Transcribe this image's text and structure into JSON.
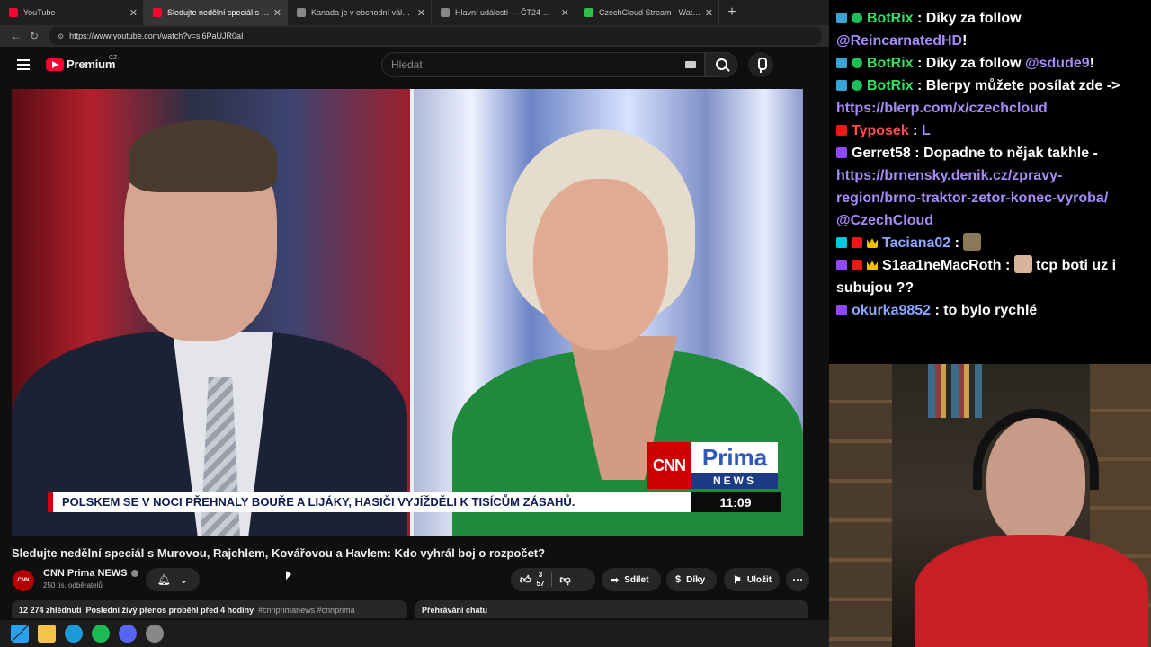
{
  "browser": {
    "tabs": [
      {
        "title": "YouTube",
        "favicon_color": "#ff0033",
        "active": false
      },
      {
        "title": "Sledujte nedělní speciál s Murovou",
        "favicon_color": "#ff0033",
        "active": true
      },
      {
        "title": "Kanada je v obchodní válce, nebo",
        "favicon_color": "#888888",
        "active": false
      },
      {
        "title": "Hlavní události — ČT24 — Česká t",
        "favicon_color": "#888888",
        "active": false
      },
      {
        "title": "CzechCloud Stream - Watch Live o",
        "favicon_color": "#2fbf4a",
        "active": false
      }
    ],
    "url": "https://www.youtube.com/watch?v=sl6PaUJR0aI"
  },
  "youtube": {
    "brand": "Premium",
    "country": "CZ",
    "search_placeholder": "Hledat"
  },
  "video": {
    "ticker": "POLSKEM SE V NOCI PŘEHNALY BOUŘE A LIJÁKY, HASIČI VYJÍŽDĚLI K TISÍCŮM ZÁSAHŮ.",
    "time": "11:09",
    "logo_cnn": "CNN",
    "logo_prima": "Prima",
    "logo_news": "NEWS"
  },
  "meta": {
    "title": "Sledujte nedělní speciál s Murovou, Rajchlem, Kovářovou a Havlem: Kdo vyhrál boj o rozpočet?",
    "channel_name": "CNN Prima NEWS",
    "subscribers": "250 tis. odběratelů",
    "like_top": "3",
    "like_bottom": "57",
    "share_label": "Sdílet",
    "thanks_label": "Díky",
    "save_label": "Uložit",
    "views": "12 274 zhlédnutí",
    "stream_info": "Poslední živý přenos proběhl před 4 hodiny",
    "hashtags": "#cnnprimanews #cnnprima",
    "chat_replay": "Přehrávání chatu"
  },
  "chat": [
    {
      "user": "BotRix",
      "color": "#32e35b",
      "badges": [
        "bot",
        "check"
      ],
      "parts": [
        {
          "t": " : Díky za follow ",
          "link": false
        },
        {
          "t": "@ReincarnatedHD",
          "link": true
        },
        {
          "t": "!",
          "link": false
        }
      ]
    },
    {
      "user": "BotRix",
      "color": "#32e35b",
      "badges": [
        "bot",
        "check"
      ],
      "parts": [
        {
          "t": " : Díky za follow ",
          "link": false
        },
        {
          "t": "@sdude9",
          "link": true
        },
        {
          "t": "!",
          "link": false
        }
      ]
    },
    {
      "user": "BotRix",
      "color": "#32e35b",
      "badges": [
        "bot",
        "check"
      ],
      "parts": [
        {
          "t": " : Blerpy můžete posílat zde -> ",
          "link": false
        },
        {
          "t": "https://blerp.com/x/czechcloud",
          "link": true
        }
      ]
    },
    {
      "user": "Typosek",
      "color": "#ff4d4d",
      "badges": [
        "red"
      ],
      "parts": [
        {
          "t": " : ",
          "link": false
        },
        {
          "t": "L",
          "link": true
        }
      ]
    },
    {
      "user": "Gerret58",
      "color": "#ffffff",
      "badges": [
        "prime"
      ],
      "parts": [
        {
          "t": " : Dopadne to nějak takhle - ",
          "link": false
        },
        {
          "t": "https://brnensky.denik.cz/zpravy-region/brno-traktor-zetor-konec-vyroba/",
          "link": true
        },
        {
          "t": " ",
          "link": false
        },
        {
          "t": "@CzechCloud",
          "link": true
        }
      ]
    },
    {
      "user": "Taciana02",
      "color": "#8fa8ff",
      "badges": [
        "cyan",
        "red",
        "crown"
      ],
      "parts": [
        {
          "t": " : ",
          "link": false
        }
      ]
    },
    {
      "user": "S1aa1neMacRoth",
      "color": "#ffffff",
      "badges": [
        "prime",
        "red",
        "crown"
      ],
      "parts": [
        {
          "t": " : ",
          "link": false
        },
        {
          "t": " tcp boti uz i subujou ??",
          "link": false
        }
      ]
    },
    {
      "user": "okurka9852",
      "color": "#8fa8ff",
      "badges": [
        "prime"
      ],
      "parts": [
        {
          "t": " : to bylo rychlé",
          "link": false
        }
      ]
    }
  ],
  "taskbar": [
    "windows-start",
    "file-explorer",
    "edge",
    "spotify",
    "discord",
    "other-app"
  ]
}
